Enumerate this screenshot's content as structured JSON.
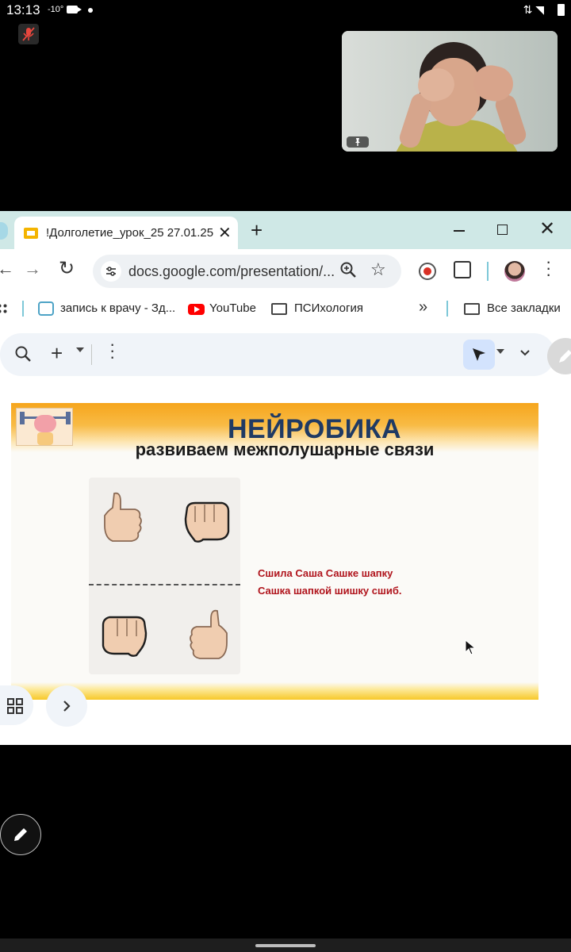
{
  "status_bar": {
    "time": "13:13",
    "temperature": "-10°"
  },
  "browser": {
    "tab_title": "!Долголетие_урок_25 27.01.25",
    "url": "docs.google.com/presentation/...",
    "bookmarks": [
      {
        "label": "запись к врачу - Зд..."
      },
      {
        "label": "YouTube"
      },
      {
        "label": "ПСИхология"
      }
    ],
    "bookmarks_more": "»",
    "all_bookmarks": "Все закладки"
  },
  "slide": {
    "title": "НЕЙРОБИКА",
    "subtitle": "развиваем межполушарные связи",
    "tongue_twister": [
      "Сшила Саша Сашке шапку",
      "Сашка шапкой шишку сшиб."
    ]
  },
  "colors": {
    "slide_title": "#1f3a63",
    "slide_text": "#b0141c",
    "tab_strip": "#cfe8e6",
    "slide_band": "#f6a51c"
  },
  "icons": {
    "status": [
      "camera-icon",
      "wifi-icon",
      "battery-icon"
    ],
    "meeting": [
      "mic-muted-icon",
      "pin-icon",
      "edit-icon"
    ],
    "browser": [
      "close-icon",
      "plus-icon",
      "minimize-icon",
      "maximize-icon",
      "back-icon",
      "forward-icon",
      "reload-icon",
      "site-settings-icon",
      "zoom-icon",
      "star-icon",
      "record-icon",
      "extensions-icon",
      "menu-icon",
      "apps-icon",
      "folder-icon"
    ],
    "slides": [
      "search-icon",
      "plus-icon",
      "more-icon",
      "pointer-icon",
      "chevron-down-icon",
      "grid-icon",
      "chevron-right-icon"
    ]
  }
}
